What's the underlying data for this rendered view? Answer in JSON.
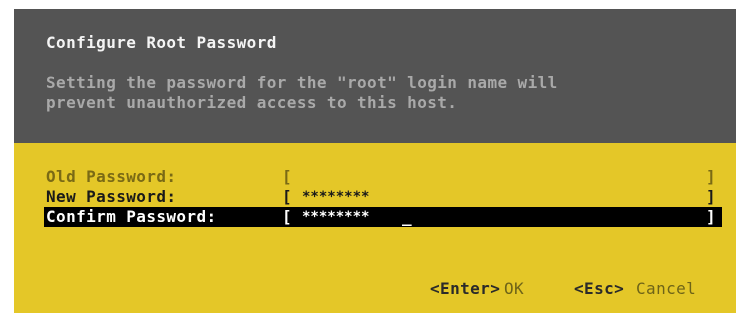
{
  "dialog": {
    "title": "Configure Root Password",
    "description_line1": "Setting the password for the \"root\" login name will",
    "description_line2": "prevent unauthorized access to this host."
  },
  "fields": {
    "old_password": {
      "label": "Old Password:",
      "value": ""
    },
    "new_password": {
      "label": "New Password:",
      "value": "********"
    },
    "confirm_password": {
      "label": "Confirm Password:",
      "value": "********"
    },
    "bracket_open": "[",
    "bracket_close": "]",
    "cursor": "_"
  },
  "footer": {
    "enter_key": "<Enter>",
    "ok_label": "OK",
    "esc_key": "<Esc>",
    "cancel_label": "Cancel"
  },
  "colors": {
    "header_bg": "#545454",
    "body_bg": "#e4c728",
    "selected_row_bg": "#000000"
  }
}
